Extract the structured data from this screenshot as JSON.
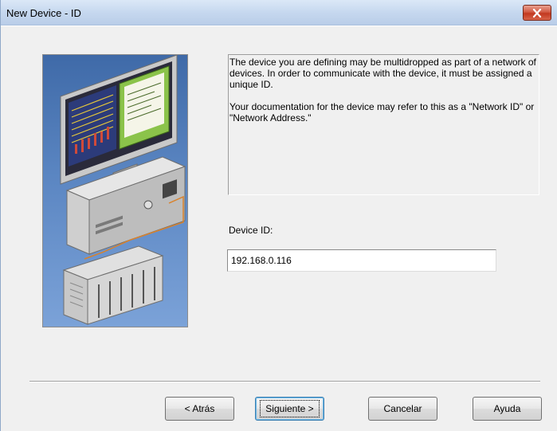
{
  "window": {
    "title": "New Device - ID",
    "close_icon": "close-icon"
  },
  "info": {
    "paragraph1": "The device you are defining may be multidropped as part of a network of devices.  In order to communicate with the device, it must be assigned a unique ID.",
    "paragraph2": "Your documentation for the device may refer to this as a \"Network ID\" or \"Network Address.\""
  },
  "device_id": {
    "label": "Device ID:",
    "value": "192.168.0.116"
  },
  "buttons": {
    "back": "< Atrás",
    "next": "Siguiente >",
    "cancel": "Cancelar",
    "help": "Ayuda"
  },
  "colors": {
    "illustration_bg": "#5b86c2",
    "close_button": "#c2381f",
    "titlebar": "#c6d8ef"
  }
}
